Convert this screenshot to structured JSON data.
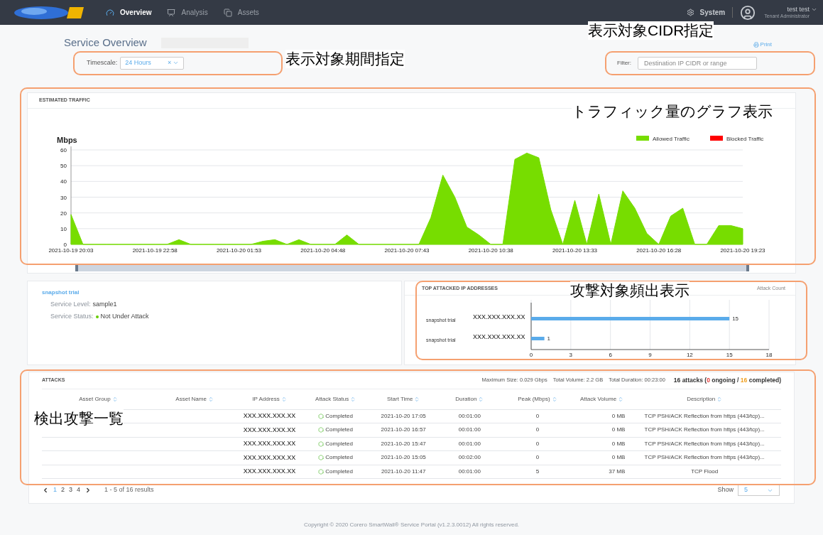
{
  "nav": {
    "items": [
      {
        "label": "Overview",
        "selected": true
      },
      {
        "label": "Analysis",
        "selected": false
      },
      {
        "label": "Assets",
        "selected": false
      }
    ],
    "system": "System",
    "user": {
      "name": "test test",
      "role": "Tenant Administrator"
    }
  },
  "header": {
    "title": "Service Overview",
    "print": "Print",
    "timescale": {
      "label": "Timescale:",
      "value": "24 Hours",
      "clear": "×"
    },
    "filter": {
      "label": "Filter:",
      "placeholder": "Destination IP CIDR or range"
    }
  },
  "traffic": {
    "title": "ESTIMATED TRAFFIC",
    "chart_data": {
      "type": "area",
      "ylabel": "Mbps",
      "categories": [
        "2021-10-19 20:03",
        null,
        null,
        null,
        null,
        null,
        null,
        "2021-10-19 22:58",
        null,
        null,
        null,
        null,
        null,
        null,
        "2021-10-20 01:53",
        null,
        null,
        null,
        null,
        null,
        null,
        "2021-10-20 04:48",
        null,
        null,
        null,
        null,
        null,
        null,
        "2021-10-20 07:43",
        null,
        null,
        null,
        null,
        null,
        null,
        "2021-10-20 10:38",
        null,
        null,
        null,
        null,
        null,
        null,
        "2021-10-20 13:33",
        null,
        null,
        null,
        null,
        null,
        null,
        "2021-10-20 16:28",
        null,
        null,
        null,
        null,
        null,
        null,
        "2021-10-20 19:23"
      ],
      "ylim": [
        0,
        60
      ],
      "yticks": [
        0,
        10,
        20,
        30,
        40,
        50,
        60
      ],
      "series": [
        {
          "name": "Allowed Traffic",
          "color": "#77dd00",
          "values": [
            19,
            0,
            0,
            0,
            0,
            0,
            0,
            0,
            0,
            3,
            0,
            0,
            0,
            0,
            0,
            0,
            2,
            3,
            0,
            3,
            0,
            0,
            0,
            6,
            0,
            0,
            0,
            0,
            0,
            0,
            17,
            44,
            30,
            11,
            6,
            0,
            0,
            54,
            58,
            55,
            22,
            0,
            28,
            0,
            32,
            0,
            34,
            23,
            7,
            0,
            18,
            23,
            0,
            0,
            12,
            12,
            10
          ]
        },
        {
          "name": "Blocked Traffic",
          "color": "#ff0000",
          "values": [
            null,
            null,
            null,
            null,
            null,
            null,
            null,
            null,
            null,
            null,
            null,
            null,
            null,
            null,
            null,
            null,
            null,
            null,
            null,
            null,
            null,
            null,
            null,
            null,
            null,
            null,
            null,
            null,
            null,
            null,
            null,
            null,
            null,
            null,
            null,
            null,
            null,
            null,
            null,
            null,
            null,
            null,
            null,
            null,
            null,
            null,
            null,
            null,
            null,
            null,
            null,
            null,
            null,
            null,
            null,
            null,
            null
          ]
        }
      ],
      "grid": true
    }
  },
  "service": {
    "name": "snapshot trial",
    "fields": [
      {
        "label": "Service Level:",
        "value": "sample1"
      },
      {
        "label": "Service Status:",
        "value": "Not Under Attack",
        "color": "#66cc00"
      }
    ]
  },
  "top_attacked": {
    "title": "TOP ATTACKED IP ADDRESSES",
    "subtitle": "Attack Count",
    "groups": [
      "snapshot trial",
      "snapshot trial"
    ],
    "chart_data": {
      "type": "bar",
      "orientation": "horizontal",
      "categories": [
        "XXX.XXX.XXX.XX",
        "XXX.XXX.XXX.XX"
      ],
      "values": [
        15,
        1
      ],
      "grid": true,
      "xlim": [
        0,
        18
      ],
      "xticks": [
        0,
        3,
        6,
        9,
        12,
        15,
        18
      ],
      "data_labels": true
    }
  },
  "attacks": {
    "title": "ATTACKS",
    "summary": [
      "Maximum Size: 0.029 Gbps",
      "Total Volume: 2.2 GB",
      "Total Duration: 00:23:00"
    ],
    "counts": [
      {
        "text": "16 attacks (",
        "color": "#333333"
      },
      {
        "text": "0",
        "color": "#e53935"
      },
      {
        "text": " ongoing / ",
        "color": "#333333"
      },
      {
        "text": "16",
        "color": "#f0a020"
      },
      {
        "text": " completed)",
        "color": "#333333"
      }
    ],
    "columns": [
      "Asset Group",
      "Asset Name",
      "IP Address",
      "Attack Status",
      "Start Time",
      "Duration",
      "Peak (Mbps)",
      "Attack Volume",
      "Description"
    ],
    "rows": [
      {
        "ip": "XXX.XXX.XXX.XX",
        "status": "Completed",
        "start": "2021-10-20 17:05",
        "duration": "00:01:00",
        "peak": "0",
        "volume": "0 MB",
        "description": "TCP PSH/ACK Reflection from https (443/tcp)..."
      },
      {
        "ip": "XXX.XXX.XXX.XX",
        "status": "Completed",
        "start": "2021-10-20 16:57",
        "duration": "00:01:00",
        "peak": "0",
        "volume": "0 MB",
        "description": "TCP PSH/ACK Reflection from https (443/tcp)..."
      },
      {
        "ip": "XXX.XXX.XXX.XX",
        "status": "Completed",
        "start": "2021-10-20 15:47",
        "duration": "00:01:00",
        "peak": "0",
        "volume": "0 MB",
        "description": "TCP PSH/ACK Reflection from https (443/tcp)..."
      },
      {
        "ip": "XXX.XXX.XXX.XX",
        "status": "Completed",
        "start": "2021-10-20 15:05",
        "duration": "00:02:00",
        "peak": "0",
        "volume": "0 MB",
        "description": "TCP PSH/ACK Reflection from https (443/tcp)..."
      },
      {
        "ip": "XXX.XXX.XXX.XX",
        "status": "Completed",
        "start": "2021-10-20 11:47",
        "duration": "00:01:00",
        "peak": "5",
        "volume": "37 MB",
        "description": "TCP Flood"
      }
    ],
    "pages": [
      {
        "label": "1",
        "selected": true
      },
      {
        "label": "2",
        "selected": false
      },
      {
        "label": "3",
        "selected": false
      },
      {
        "label": "4",
        "selected": false
      }
    ],
    "results": "1 - 5 of 16 results",
    "show_label": "Show",
    "show_value": "5"
  },
  "footer": "Copyright © 2020 Corero SmartWall® Service Portal (v1.2.3.0012) All rights reserved.",
  "annotations": [
    {
      "text": "表示対象期間指定"
    },
    {
      "text": "表示対象CIDR指定"
    },
    {
      "text": "トラフィック量のグラフ表示"
    },
    {
      "text": "攻撃対象頻出表示"
    },
    {
      "text": "検出攻撃一覧"
    }
  ]
}
